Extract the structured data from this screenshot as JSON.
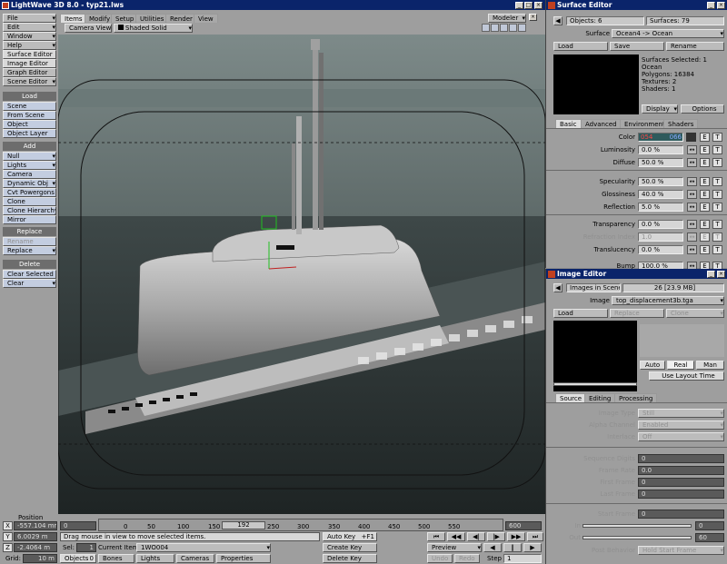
{
  "app_title": "LightWave 3D 8.0 - typ21.lws",
  "left_menu": {
    "top": [
      {
        "label": "File"
      },
      {
        "label": "Edit"
      },
      {
        "label": "Window"
      },
      {
        "label": "Help"
      },
      {
        "label": "Surface Editor",
        "key": "F5"
      },
      {
        "label": "Image Editor",
        "key": "F6"
      },
      {
        "label": "Graph Editor"
      },
      {
        "label": "Scene Editor"
      }
    ],
    "load_header": "Load",
    "load_items": [
      "Scene",
      "From Scene",
      "Object",
      "Object Layer"
    ],
    "add_header": "Add",
    "add_items": [
      "Null",
      "Lights",
      "Camera",
      "Dynamic Obj",
      "Cvt Powergons",
      "Clone",
      "Clone Hierarchy",
      "Mirror"
    ],
    "replace_header": "Replace",
    "replace_items": [
      "Rename",
      "Replace"
    ],
    "delete_header": "Delete",
    "delete_items": [
      "Clear Selected",
      "Clear"
    ]
  },
  "tabs": [
    "Items",
    "Modify",
    "Setup",
    "Utilities",
    "Render",
    "View"
  ],
  "modeler_label": "Modeler",
  "viewport": {
    "view_mode": "Camera View",
    "shading": "Shaded Solid"
  },
  "surface_editor": {
    "title": "Surface Editor",
    "objects": "Objects: 6",
    "surfaces": "Surfaces: 79",
    "surface_label": "Surface",
    "surface_value": "Ocean4 -> Ocean",
    "buttons": [
      "Load",
      "Save",
      "Rename"
    ],
    "info": [
      "Surfaces Selected: 1",
      "Ocean",
      "Polygons: 16384",
      "Textures: 2",
      "Shaders: 1"
    ],
    "display_label": "Display",
    "options_label": "Options",
    "tabs": [
      "Basic",
      "Advanced",
      "Environment",
      "Shaders"
    ],
    "color_label": "Color",
    "color_r": "054",
    "color_g": "",
    "color_b": "066",
    "props": [
      {
        "label": "Luminosity",
        "value": "0.0 %"
      },
      {
        "label": "Diffuse",
        "value": "50.0 %"
      },
      {
        "label": "Specularity",
        "value": "50.0 %"
      },
      {
        "label": "Glossiness",
        "value": "40.0 %"
      },
      {
        "label": "Reflection",
        "value": "5.0 %"
      },
      {
        "label": "Transparency",
        "value": "0.0 %"
      },
      {
        "label": "Refraction Index",
        "value": "1.0"
      },
      {
        "label": "Translucency",
        "value": "0.0 %"
      },
      {
        "label": "Bump",
        "value": "100.0 %"
      }
    ],
    "e_label": "E",
    "t_label": "T"
  },
  "image_editor": {
    "title": "Image Editor",
    "images_in_scene": "Images in Scene",
    "images_count": "26 [23.9 MB]",
    "image_label": "Image",
    "image_value": "top_displacement3b.tga",
    "buttons": [
      "Load",
      "Replace",
      "Clone"
    ],
    "auto": "Auto",
    "real": "Real",
    "man": "Man",
    "use_layout_time": "Use Layout Time",
    "tabs": [
      "Source",
      "Editing",
      "Processing"
    ],
    "image_type_label": "Image Type",
    "image_type": "Still",
    "alpha_label": "Alpha Channel",
    "alpha": "Enabled",
    "interlace_label": "Interlace",
    "interlace": "Off",
    "seq_label": "Sequence Digits",
    "seq": "0",
    "frame_rate_label": "Frame Rate",
    "frame_rate": "0.0",
    "first_frame_label": "First Frame",
    "first_frame": "0",
    "last_frame_label": "Last Frame",
    "last_frame": "0",
    "start_frame_label": "Start Frame",
    "start_frame": "0",
    "in_label": "In",
    "in_value": "0",
    "out_label": "Out",
    "out_value": "60",
    "post_label": "Post Behavior",
    "post_value": "Hold Start Frame"
  },
  "timeline": {
    "ticks": [
      "0",
      "50",
      "100",
      "150",
      "200",
      "250",
      "300",
      "350",
      "400",
      "450",
      "500",
      "550",
      "600"
    ],
    "current": "192",
    "end": "600",
    "start": "0"
  },
  "position": {
    "label": "Position",
    "x": "-557.104 mm",
    "y": "6.0029 m",
    "z": "-2.4064 m",
    "grid_label": "Grid:",
    "grid": "10 m",
    "axis_x": "X",
    "axis_y": "Y",
    "axis_z": "Z"
  },
  "status": {
    "message": "Drag mouse in view to move selected items.",
    "sel_label": "Sel:",
    "sel": "1",
    "current_item_label": "Current Item",
    "current_item": "1WO004",
    "bottom_tabs": [
      "Objects",
      "Bones",
      "Lights",
      "Cameras",
      "Properties"
    ],
    "objects_count": "0",
    "auto_key": "Auto Key",
    "auto_key_key": "+F1",
    "create_key": "Create Key",
    "delete_key": "Delete Key",
    "preview": "Preview",
    "step_label": "Step",
    "step": "1",
    "undo": "Undo",
    "redo": "Redo"
  },
  "colors": {
    "titlebar": "#0a246a",
    "panel": "#9e9e9e",
    "viewport_sky": "#6e7a79",
    "ocean": "#2f3838"
  }
}
